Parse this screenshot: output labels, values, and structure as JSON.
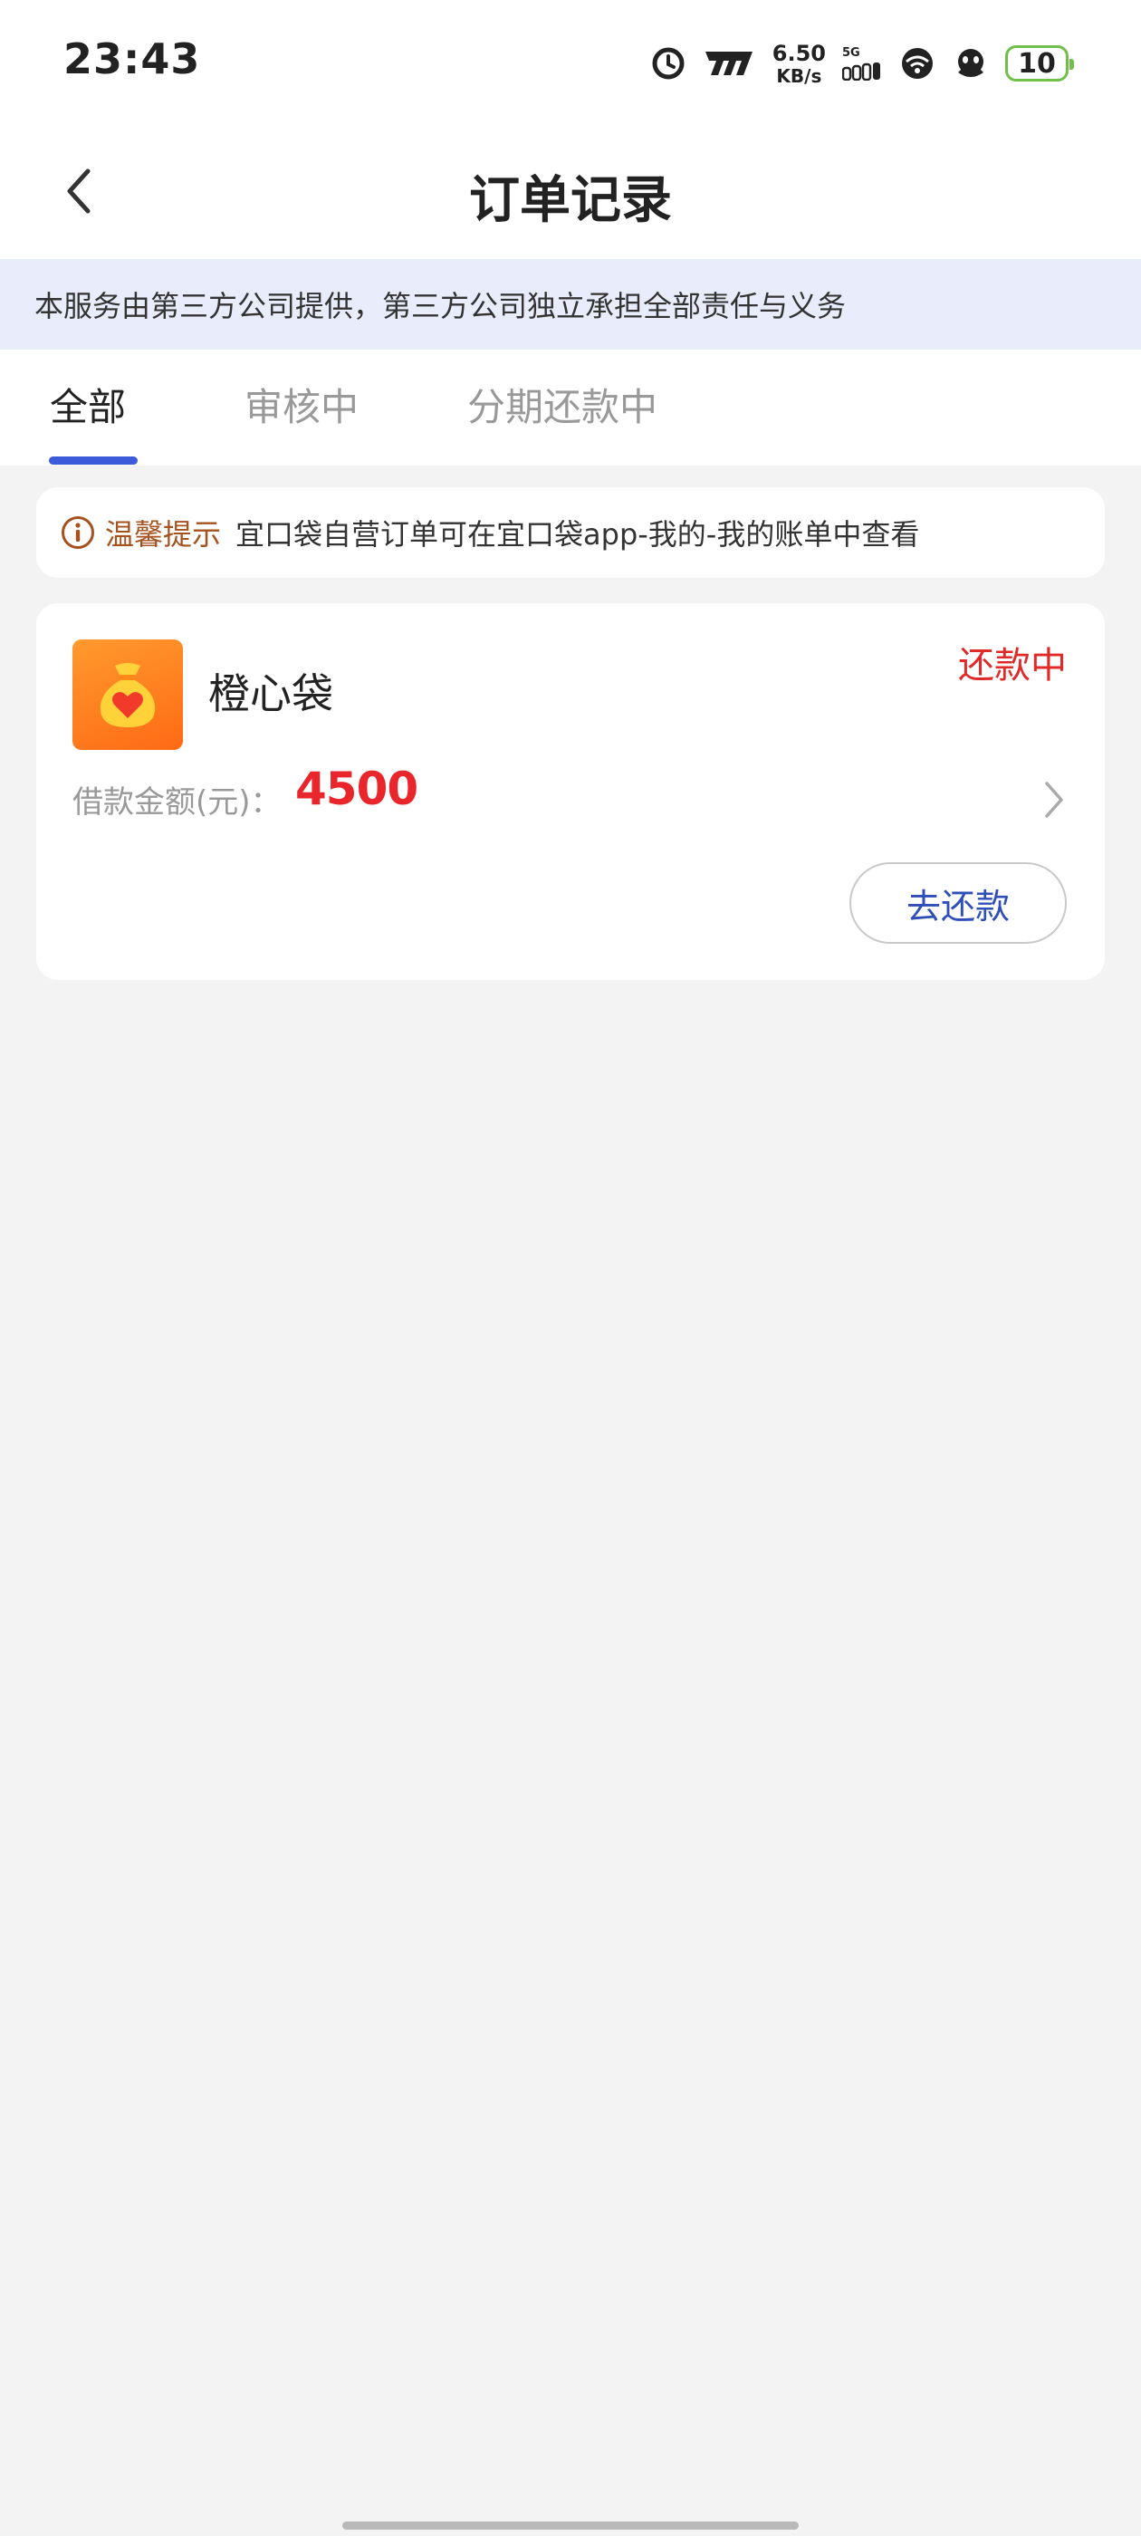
{
  "status_bar": {
    "time": "23:43",
    "net_speed_value": "6.50",
    "net_speed_unit": "KB/s",
    "network_tag": "5G",
    "battery_level": "10",
    "battery_color": "#6fbf4a"
  },
  "nav": {
    "title": "订单记录",
    "back_icon": "chevron-left-icon"
  },
  "notice": {
    "text": "本服务由第三方公司提供，第三方公司独立承担全部责任与义务"
  },
  "tabs": {
    "items": [
      {
        "label": "全部",
        "active": true
      },
      {
        "label": "审核中",
        "active": false
      },
      {
        "label": "分期还款中",
        "active": false
      }
    ],
    "accent_color": "#3b5bdb"
  },
  "tip": {
    "label": "温馨提示",
    "text": "宜口袋自营订单可在宜口袋app-我的-我的账单中查看"
  },
  "order": {
    "merchant_name": "橙心袋",
    "status": "还款中",
    "amount_label": "借款金额(元)：",
    "amount_value": "4500",
    "action_label": "去还款",
    "status_color": "#e02a2a"
  }
}
